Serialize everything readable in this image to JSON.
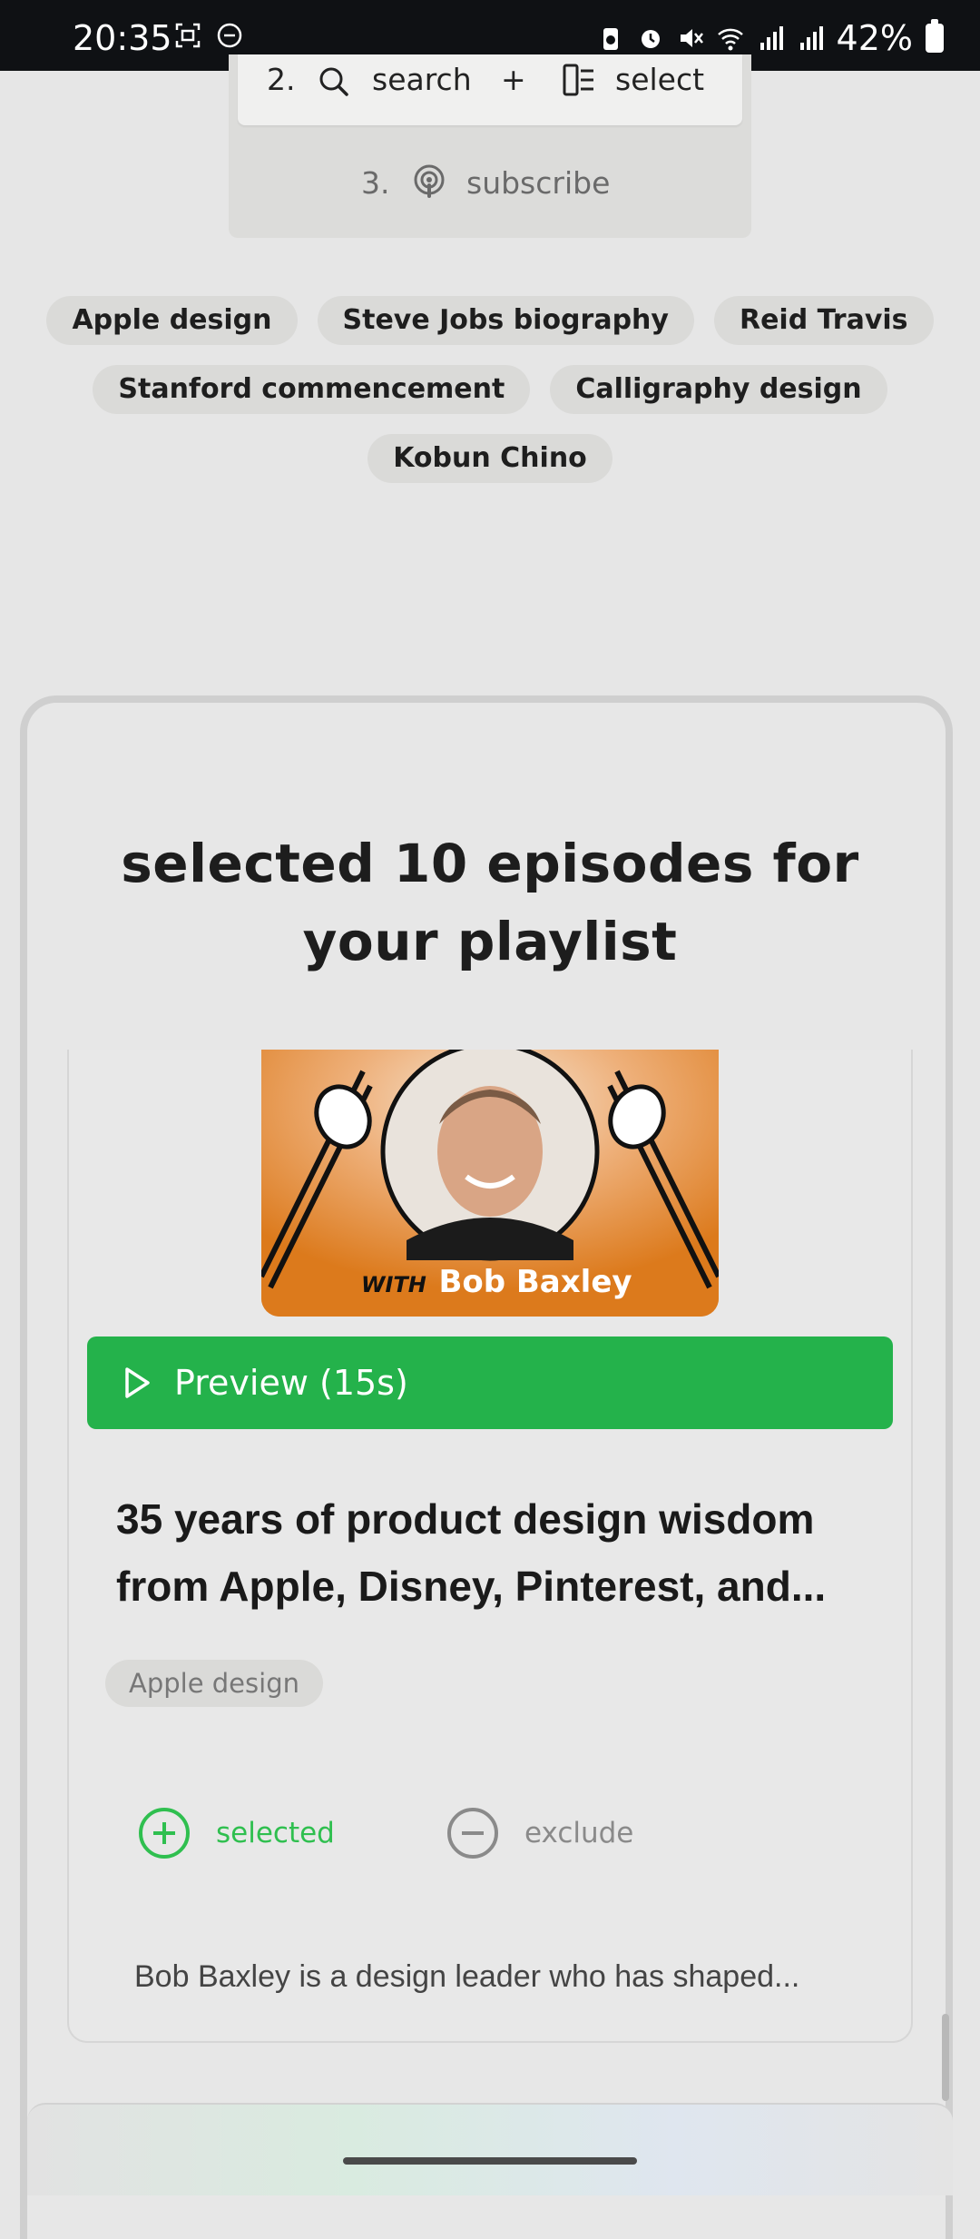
{
  "status_bar": {
    "time": "20:35",
    "battery": "42%"
  },
  "steps": {
    "step2": {
      "number": "2.",
      "search_label": "search",
      "plus": "+",
      "select_label": "select"
    },
    "step3": {
      "number": "3.",
      "subscribe_label": "subscribe"
    }
  },
  "tags": [
    [
      "Apple design",
      "Steve Jobs biography",
      "Reid Travis"
    ],
    [
      "Stanford commencement",
      "Calligraphy design"
    ],
    [
      "Kobun Chino"
    ]
  ],
  "playlist": {
    "title": "selected 10 episodes for your playlist",
    "episode": {
      "cover_text_prefix": "WITH",
      "cover_text_name": "Bob Baxley",
      "preview_label": "Preview (15s)",
      "title": "35 years of product design wisdom from Apple, Disney, Pinterest, and...",
      "tag": "Apple design",
      "selected_label": "selected",
      "exclude_label": "exclude",
      "description": "Bob Baxley is a design leader who has shaped..."
    }
  },
  "colors": {
    "accent_green": "#24b24b",
    "selected_green": "#2fbf4f",
    "cover_orange": "#dc7a1c"
  }
}
